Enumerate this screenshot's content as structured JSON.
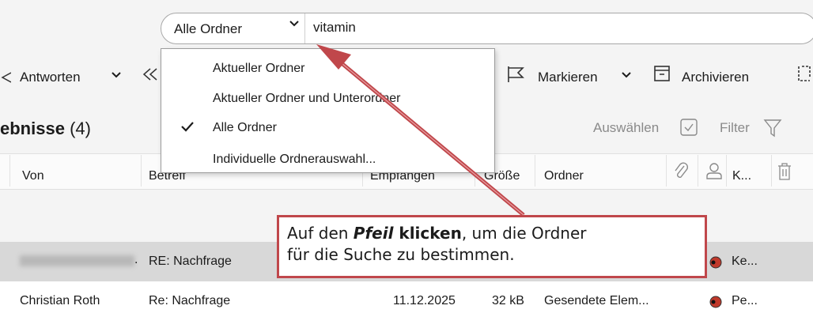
{
  "search": {
    "scope": "Alle Ordner",
    "query": "vitamin"
  },
  "toolbar": {
    "reply": "Antworten",
    "mark": "Markieren",
    "archive": "Archivieren"
  },
  "scope_menu": {
    "options": [
      {
        "label": "Aktueller Ordner",
        "checked": false
      },
      {
        "label": "Aktueller Ordner und Unterordner",
        "checked": false
      },
      {
        "label": "Alle Ordner",
        "checked": true
      },
      {
        "label": "Individuelle Ordnerauswahl...",
        "checked": false
      }
    ]
  },
  "results": {
    "title": "ebnisse",
    "count": "(4)",
    "select": "Auswählen",
    "filter": "Filter"
  },
  "columns": {
    "from": "Von",
    "subject": "Betreff",
    "received": "Empfangen",
    "size": "Größe",
    "folder": "Ordner",
    "category": "K..."
  },
  "rows": [
    {
      "from": "",
      "subject": "RE: Nachfrage",
      "received": "",
      "size": "",
      "folder": "",
      "category": "Ke..."
    },
    {
      "from": "Christian Roth",
      "subject": "Re: Nachfrage",
      "received": "11.12.2025",
      "size": "32 kB",
      "folder": "Gesendete Elem...",
      "category": "Pe..."
    }
  ],
  "callout": {
    "line1_pre": "Auf den ",
    "line1_em": "Pfeil",
    "line1_strong": " klicken",
    "line1_post": ", um die Ordner",
    "line2": "für die Suche zu bestimmen."
  },
  "colors": {
    "callout_border": "#c0474b",
    "arrow": "#c0474b",
    "category_dot": "#c0392b"
  }
}
